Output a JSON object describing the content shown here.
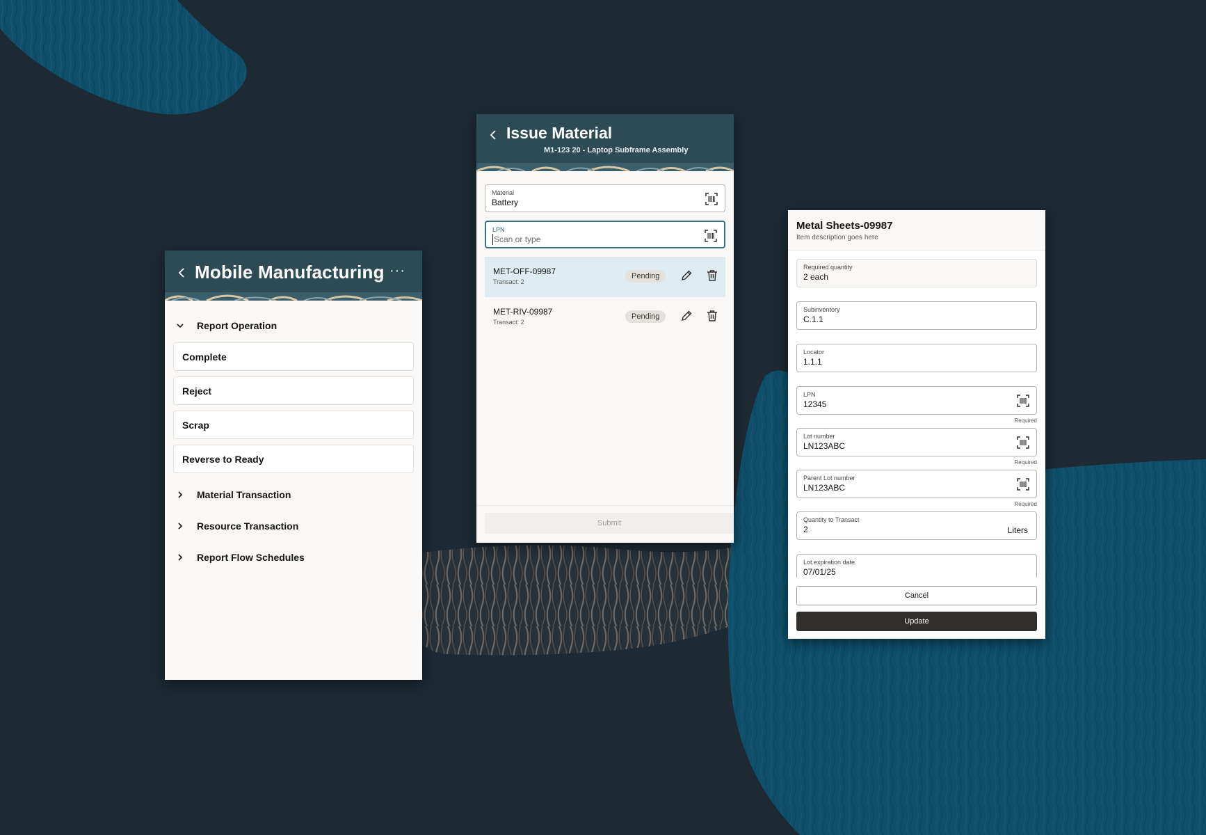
{
  "colors": {
    "background": "#1d2a33",
    "header": "#2d4b55",
    "accent_blue": "#0f4f6b",
    "selected_row": "#deebf1",
    "primary_button": "#312d2a"
  },
  "screen_menu": {
    "title": "Mobile Manufacturing",
    "back_icon": "chevron-left-icon",
    "more_label": "···",
    "expanded_section": {
      "label": "Report Operation",
      "items": [
        "Complete",
        "Reject",
        "Scrap",
        "Reverse to Ready"
      ]
    },
    "collapsed_sections": [
      "Material Transaction",
      "Resource Transaction",
      "Report Flow Schedules"
    ]
  },
  "screen_issue": {
    "title": "Issue Material",
    "subtitle": "M1-123 20 - Laptop Subframe Assembly",
    "material": {
      "label": "Material",
      "value": "Battery"
    },
    "lpn": {
      "label": "LPN",
      "placeholder": "Scan or type"
    },
    "rows": [
      {
        "code": "MET-OFF-09987",
        "sub": "Transact: 2",
        "status": "Pending",
        "selected": true
      },
      {
        "code": "MET-RIV-09987",
        "sub": "Transact: 2",
        "status": "Pending",
        "selected": false
      }
    ],
    "submit_label": "Submit"
  },
  "screen_detail": {
    "title": "Metal Sheets-09987",
    "description": "Item description goes here",
    "fields": {
      "required_qty": {
        "label": "Required quantity",
        "value": "2 each"
      },
      "subinventory": {
        "label": "Subinventory",
        "value": "C.1.1"
      },
      "locator": {
        "label": "Locator",
        "value": "1.1.1"
      },
      "lpn": {
        "label": "LPN",
        "value": "12345",
        "hint": "Required"
      },
      "lot": {
        "label": "Lot number",
        "value": "LN123ABC",
        "hint": "Required"
      },
      "parent_lot": {
        "label": "Parent Lot number",
        "value": "LN123ABC",
        "hint": "Required"
      },
      "qty_transact": {
        "label": "Quantity to Transact",
        "value": "2",
        "unit": "Liters"
      },
      "lot_expiration": {
        "label": "Lot expiration date",
        "value": "07/01/25"
      }
    },
    "cancel_label": "Cancel",
    "update_label": "Update"
  }
}
